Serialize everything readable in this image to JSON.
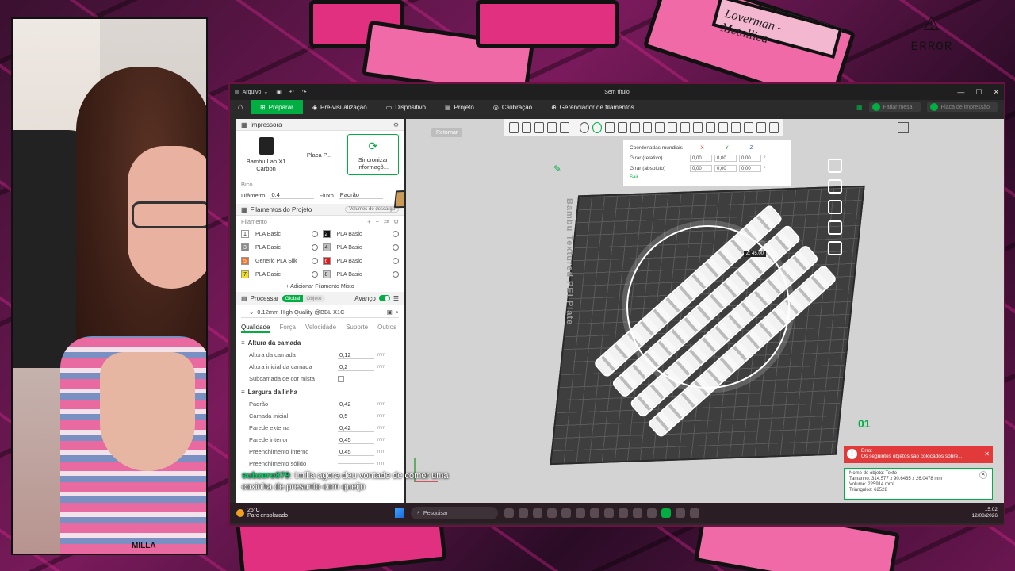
{
  "overlay": {
    "error_tag": "ERROR",
    "sticker": "Loverman - Metallica",
    "tape_label": "MILLA"
  },
  "window": {
    "menu_file": "Arquivo",
    "title": "Sem título",
    "min": "—",
    "max": "☐",
    "close": "✕"
  },
  "nav": {
    "tabs": [
      "Preparar",
      "Pré-visualização",
      "Dispositivo",
      "Projeto",
      "Calibração",
      "Gerenciador de filamentos"
    ],
    "slice_button": "Fatiar mesa",
    "print_button": "Placa de impressão"
  },
  "printer": {
    "title": "Impressora",
    "model": "Bambu Lab X1 Carbon",
    "plate": "Placa P...",
    "sync_line1": "Sincronizar",
    "sync_line2": "informaçõ...",
    "nozzle_label": "Bico",
    "diameter_label": "Diâmetro",
    "diameter_value": "0.4",
    "flow_label": "Fluxo",
    "flow_value": "Padrão"
  },
  "filaments": {
    "title": "Filamentos do Projeto",
    "volumes_btn": "Volumes de descarga",
    "label": "Filamento",
    "items": [
      {
        "num": "1",
        "name": "PLA Basic",
        "color": "#ffffff"
      },
      {
        "num": "2",
        "name": "PLA Basic",
        "color": "#111111"
      },
      {
        "num": "3",
        "name": "PLA Basic",
        "color": "#8a8a8a"
      },
      {
        "num": "4",
        "name": "PLA Basic",
        "color": "#bdbdbd"
      },
      {
        "num": "5",
        "name": "Generic PLA Silk",
        "color": "#e8702a"
      },
      {
        "num": "6",
        "name": "PLA Basic",
        "color": "#d62020"
      },
      {
        "num": "7",
        "name": "PLA Basic",
        "color": "#f5e020"
      },
      {
        "num": "8",
        "name": "PLA Basic",
        "color": "#cccccc"
      }
    ],
    "add_mixed": "Adicionar Filamento Misto"
  },
  "process": {
    "title": "Processar",
    "toggle_global": "Global",
    "toggle_object": "Objeto",
    "advanced": "Avanço",
    "preset": "0.12mm High Quality @BBL X1C",
    "tabs": [
      "Qualidade",
      "Força",
      "Velocidade",
      "Suporte",
      "Outros"
    ],
    "group1": "Altura da camada",
    "layer_height": {
      "label": "Altura da camada",
      "value": "0,12",
      "unit": "mm"
    },
    "first_layer": {
      "label": "Altura inicial da camada",
      "value": "0,2",
      "unit": "mm"
    },
    "mixed_sub": {
      "label": "Subcamada de cor mista"
    },
    "group2": "Largura da linha",
    "widths": [
      {
        "label": "Padrão",
        "value": "0,42",
        "unit": "mm"
      },
      {
        "label": "Camada inicial",
        "value": "0,5",
        "unit": "mm"
      },
      {
        "label": "Parede externa",
        "value": "0,42",
        "unit": "mm"
      },
      {
        "label": "Parede interior",
        "value": "0,45",
        "unit": "mm"
      },
      {
        "label": "Preenchimento interno",
        "value": "0,45",
        "unit": "mm"
      },
      {
        "label": "Preenchimento sólido",
        "value": "",
        "unit": "mm"
      }
    ]
  },
  "viewport": {
    "return_btn": "Retornar",
    "plate_label": "Bambu Textured PEI Plate",
    "z_label": "Z: 45,00",
    "plate_number": "01",
    "coords": {
      "title": "Coordenadas mundiais",
      "x": "X",
      "y": "Y",
      "z": "Z",
      "rel_label": "Girar (relativo)",
      "abs_label": "Girar (absoluto)",
      "v": "0,00",
      "deg": "°",
      "ok": "Sair"
    }
  },
  "notifications": {
    "error_title": "Erro:",
    "error_text": "Os seguintes objetos são colocados sobre ...",
    "info_name": "Nome do objeto: Texto",
    "info_size": "Tamanho: 314.577 x 90.6465 x 26.0478 mm",
    "info_volume": "Volume: 225914 mm³",
    "info_triangles": "Triângulos: 62528"
  },
  "chat": {
    "user": "subzero879",
    "message": ": Imilla agora deu vontade de comer uma coxinha de presunto com queijo"
  },
  "taskbar": {
    "temp": "25°C",
    "weather": "Parc ensolarado",
    "search": "Pesquisar",
    "time": "15:02",
    "date": "12/08/2026"
  }
}
